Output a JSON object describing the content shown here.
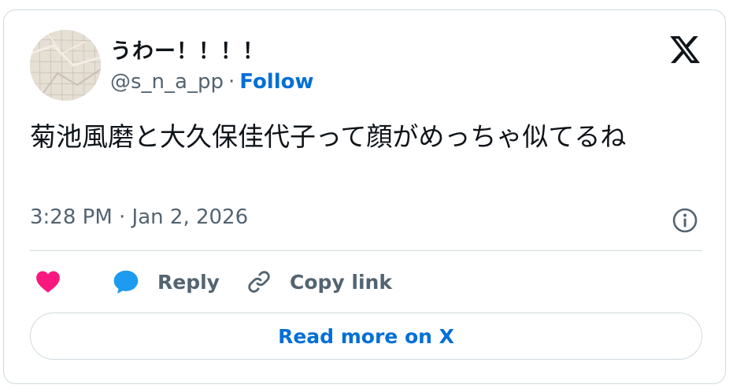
{
  "author": {
    "display_name": "うわー！！！！",
    "handle": "@s_n_a_pp",
    "separator": "·",
    "follow_label": "Follow",
    "avatar_icon": "crumpled-graph-paper-avatar"
  },
  "tweet": {
    "text": "菊池風磨と大久保佳代子って顔がめっちゃ似てるね",
    "timestamp": "3:28 PM · Jan 2, 2026"
  },
  "actions": {
    "like_icon": "heart-icon",
    "reply_label": "Reply",
    "copy_label": "Copy link"
  },
  "footer": {
    "read_more_label": "Read more on X"
  },
  "colors": {
    "link_blue": "#006fd6",
    "like_pink": "#f91880",
    "reply_blue": "#1d9bf0",
    "muted_text": "#536471",
    "border": "#cfd9de"
  },
  "icons": [
    "x-logo-icon",
    "info-icon",
    "heart-icon",
    "speech-bubble-icon",
    "link-icon"
  ]
}
